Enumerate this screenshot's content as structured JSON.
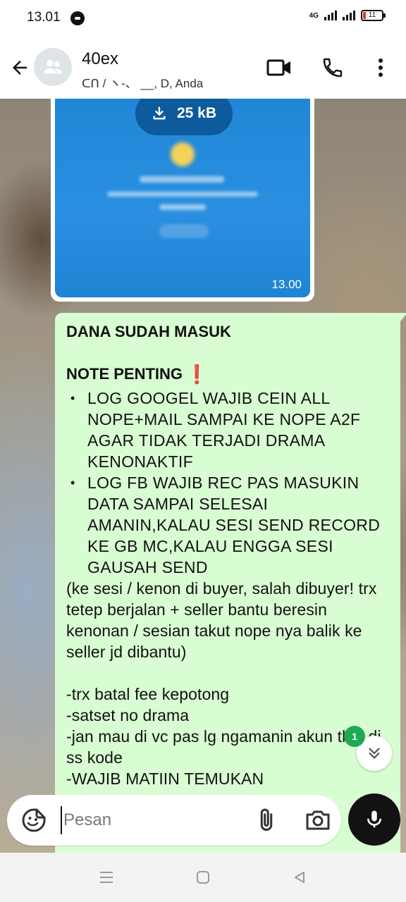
{
  "status_bar": {
    "time": "13.01",
    "network": "4G",
    "battery": "11",
    "icons": [
      "notification-icon",
      "signal-icon",
      "battery-icon"
    ]
  },
  "header": {
    "title": "40ex",
    "subtitle": "ᑕᑎ / ヽ-、 __, D, Anda",
    "icons": [
      "back-arrow-icon",
      "group-avatar-icon",
      "video-call-icon",
      "voice-call-icon",
      "more-options-icon"
    ]
  },
  "image_message": {
    "download_size": "25 kB",
    "time": "13.00"
  },
  "text_message": {
    "heading": "DANA SUDAH MASUK",
    "note_title": "NOTE PENTING",
    "note_emoji": "❗",
    "bullets": [
      "LOG GOOGEL WAJIB CEIN ALL NOPE+MAIL SAMPAI KE NOPE A2F AGAR TIDAK TERJADI DRAMA KENONAKTIF",
      "LOG FB WAJIB REC PAS MASUKIN DATA SAMPAI SELESAI AMANIN,KALAU SESI SEND RECORD KE GB MC,KALAU ENGGA SESI GAUSAH SEND"
    ],
    "paragraph": "(ke sesi / kenon di buyer, salah dibuyer! trx tetep berjalan + seller bantu beresin kenonan / sesian takut nope nya balik ke seller jd dibantu)",
    "lines": [
      "-trx batal fee kepotong",
      "-satset no drama",
      "-jan mau di vc pas lg ngamanin akun tkut di ss kode",
      "-WAJIB MATIIN TEMUKAN"
    ]
  },
  "scroll_down": {
    "unread_count": "1"
  },
  "composer": {
    "placeholder": "Pesan"
  },
  "colors": {
    "outgoing_bubble": "#d9fdd3",
    "image_bubble": "#1f86d6",
    "unread_badge": "#1fa855",
    "warning": "#e0202a"
  }
}
